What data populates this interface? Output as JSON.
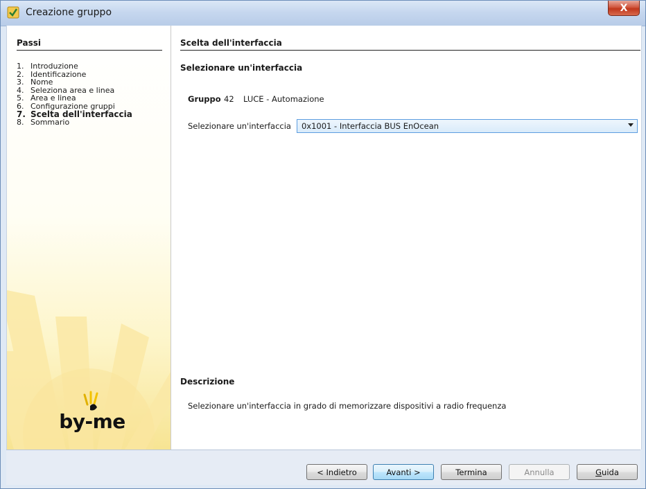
{
  "window": {
    "title": "Creazione gruppo",
    "close_glyph": "X"
  },
  "sidebar": {
    "title": "Passi",
    "steps": [
      {
        "num": "1.",
        "label": "Introduzione"
      },
      {
        "num": "2.",
        "label": "Identificazione"
      },
      {
        "num": "3.",
        "label": "Nome"
      },
      {
        "num": "4.",
        "label": "Seleziona area e linea"
      },
      {
        "num": "5.",
        "label": "Area e linea"
      },
      {
        "num": "6.",
        "label": "Configurazione gruppi"
      },
      {
        "num": "7.",
        "label": "Scelta dell'interfaccia"
      },
      {
        "num": "8.",
        "label": "Sommario"
      }
    ],
    "active_step": 7,
    "logo_text": "by-me"
  },
  "content": {
    "section_title": "Scelta dell'interfaccia",
    "subtitle": "Selezionare un'interfaccia",
    "group": {
      "label": "Gruppo",
      "number": "42",
      "name": "LUCE  - Automazione"
    },
    "interface_select": {
      "label": "Selezionare un'interfaccia",
      "value": "0x1001 - Interfaccia BUS EnOcean"
    },
    "description": {
      "title": "Descrizione",
      "text": "Selezionare un'interfaccia in grado di memorizzare dispositivi a radio frequenza"
    }
  },
  "footer": {
    "back_label": "< Indietro",
    "next_label": "Avanti >",
    "finish_label": "Termina",
    "cancel_label": "Annulla",
    "help_label_prefix": "G",
    "help_label_rest": "uida"
  },
  "colors": {
    "accent": "#3c7fb1",
    "sidebar_glow": "#f7e493",
    "close_red": "#c0371c"
  }
}
